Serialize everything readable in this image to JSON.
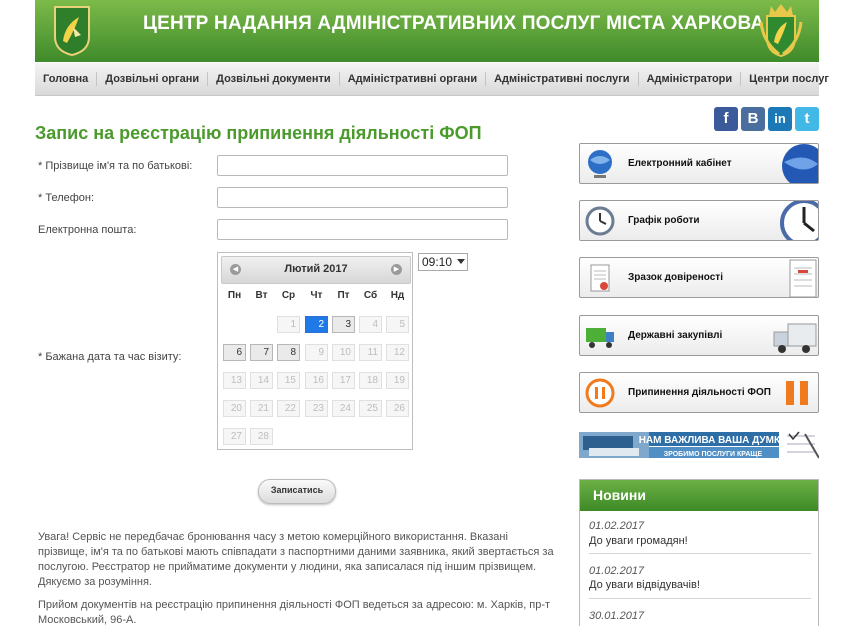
{
  "header": {
    "title": "ЦЕНТР НАДАННЯ АДМІНІСТРАТИВНИХ ПОСЛУГ МІСТА ХАРКОВА"
  },
  "nav": [
    "Головна",
    "Дозвільні органи",
    "Дозвільні документи",
    "Адміністративні органи",
    "Адміністративні послуги",
    "Адміністратори",
    "Центри послуг"
  ],
  "social": {
    "facebook": "f",
    "vkontakte": "B",
    "linkedin": "in",
    "twitter": "t"
  },
  "page_title": "Запис на реєстрацію припинення діяльності ФОП",
  "form": {
    "name_label": "* Прізвище ім'я та по батькові:",
    "phone_label": "* Телефон:",
    "email_label": "Електронна пошта:",
    "date_label": "* Бажана дата та час візиту:",
    "time_value": "09:10",
    "submit_label": "Записатись"
  },
  "calendar": {
    "month": "Лютий 2017",
    "weekdays": [
      "Пн",
      "Вт",
      "Ср",
      "Чт",
      "Пт",
      "Сб",
      "Нд"
    ],
    "rows": [
      [
        "",
        "",
        "1",
        "2",
        "3",
        "4",
        "5"
      ],
      [
        "6",
        "7",
        "8",
        "9",
        "10",
        "11",
        "12"
      ],
      [
        "13",
        "14",
        "15",
        "16",
        "17",
        "18",
        "19"
      ],
      [
        "20",
        "21",
        "22",
        "23",
        "24",
        "25",
        "26"
      ],
      [
        "27",
        "28",
        "",
        "",
        "",
        "",
        ""
      ]
    ],
    "selected": "2",
    "available": [
      "3",
      "6",
      "7",
      "8"
    ]
  },
  "notice": {
    "p1": "Увага! Сервіс не передбачає бронювання часу з метою комерційного використання. Вказані прізвище, ім'я та по батькові мають співпадати з паспортними даними заявника, який звертається за послугою. Реєстратор не прийматиме документи у людини, яка записалася під іншим прізвищем. Дякуємо за розуміння.",
    "p2": "Прийом документів на реєстрацію припинення діяльності ФОП ведеться за адресою: м. Харків, пр-т Московський, 96-А."
  },
  "sidebar": {
    "buttons": [
      "Електронний кабінет",
      "Графік роботи",
      "Зразок довіреності",
      "Державні закупівлі",
      "Припинення діяльності ФОП"
    ],
    "banner_line1": "НАМ ВАЖЛИВА ВАША ДУМКА",
    "banner_line2": "ЗРОБИМО ПОСЛУГИ КРАЩЕ"
  },
  "news": {
    "title": "Новини",
    "items": [
      {
        "date": "01.02.2017",
        "title": "До уваги громадян!"
      },
      {
        "date": "01.02.2017",
        "title": "До уваги відвідувачів!"
      },
      {
        "date": "30.01.2017",
        "title": ""
      }
    ]
  }
}
